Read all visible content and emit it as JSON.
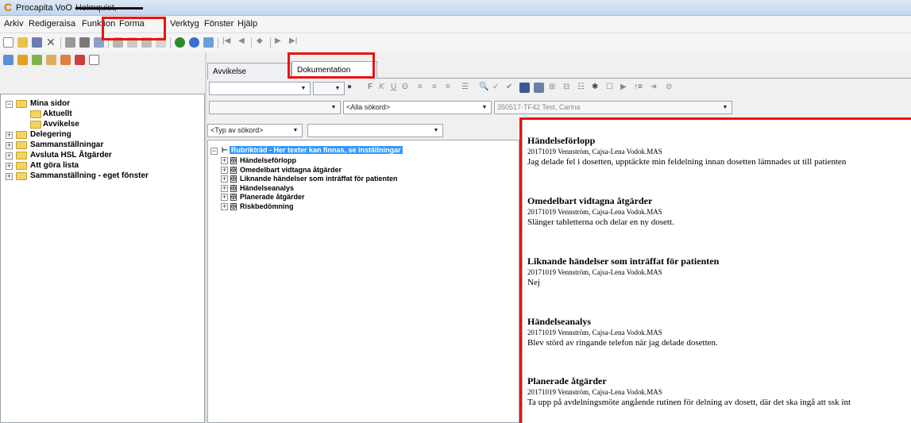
{
  "window": {
    "app_title": "Procapita VoO - ",
    "user_name": "Holmquist, Katarina"
  },
  "menubar": {
    "items": [
      "Arkiv",
      "Redigera",
      "Visa",
      "Funktion",
      "Format",
      "Verktyg",
      "Fönster",
      "Hjälp"
    ],
    "visible": [
      "Arkiv",
      "Redigera",
      "isa",
      "Funktion",
      "Forma",
      "Verktyg",
      "Fönster",
      "Hjälp"
    ]
  },
  "tabs": [
    {
      "label": "Avvikelse",
      "active": false
    },
    {
      "label": "Dokumentation",
      "active": true
    }
  ],
  "search_bar": {
    "filter": "<Alla sökord>",
    "patient": "350517-TF42 Test, Carina",
    "type_combo": "<Typ av sökord>"
  },
  "sidebar": {
    "items": [
      {
        "label": "Mina sidor",
        "expander": "−",
        "level": 0
      },
      {
        "label": "Aktuellt",
        "expander": "",
        "level": 1
      },
      {
        "label": "Avvikelse",
        "expander": "",
        "level": 1
      },
      {
        "label": "Delegering",
        "expander": "+",
        "level": 0
      },
      {
        "label": "Sammanställningar",
        "expander": "+",
        "level": 0
      },
      {
        "label": "Avsluta HSL Åtgärder",
        "expander": "+",
        "level": 0
      },
      {
        "label": "Att göra lista",
        "expander": "+",
        "level": 0
      },
      {
        "label": "Sammanställning - eget fönster",
        "expander": "+",
        "level": 0
      }
    ]
  },
  "rubric_tree": {
    "root": "Rubrikträd - Her texter kan finnas, se inställningar",
    "items": [
      "Händelseförlopp",
      "Omedelbart vidtagna åtgärder",
      "Liknande händelser som inträffat för patienten",
      "Händelseanalys",
      "Planerade åtgärder",
      "Riskbedömning"
    ]
  },
  "document": {
    "sections": [
      {
        "heading": "Händelseförlopp",
        "meta": "20171019  Vennström, Cajsa-Lena  Vodok.MAS",
        "text": "Jag delade fel i dosetten, upptäckte min feldelning innan dosetten lämnades ut till patienten"
      },
      {
        "heading": "Omedelbart vidtagna åtgärder",
        "meta": "20171019  Vennström, Cajsa-Lena  Vodok.MAS",
        "text": "Slänger tabletterna och delar en ny dosett."
      },
      {
        "heading": "Liknande händelser som inträffat för patienten",
        "meta": "20171019  Vennström, Cajsa-Lena  Vodok.MAS",
        "text": "Nej"
      },
      {
        "heading": "Händelseanalys",
        "meta": "20171019  Vennström, Cajsa-Lena  Vodok.MAS",
        "text": "Blev störd av ringande telefon när jag delade dosetten."
      },
      {
        "heading": "Planerade åtgärder",
        "meta": "20171019  Vennström, Cajsa-Lena  Vodok.MAS",
        "text": "Ta upp på avdelningsmöte angående rutinen för delning av dosett, där det ska ingå att ssk int"
      }
    ]
  },
  "colors": {
    "highlight_box": "#e11111",
    "selection": "#3399ff",
    "folder": "#f3d463"
  }
}
